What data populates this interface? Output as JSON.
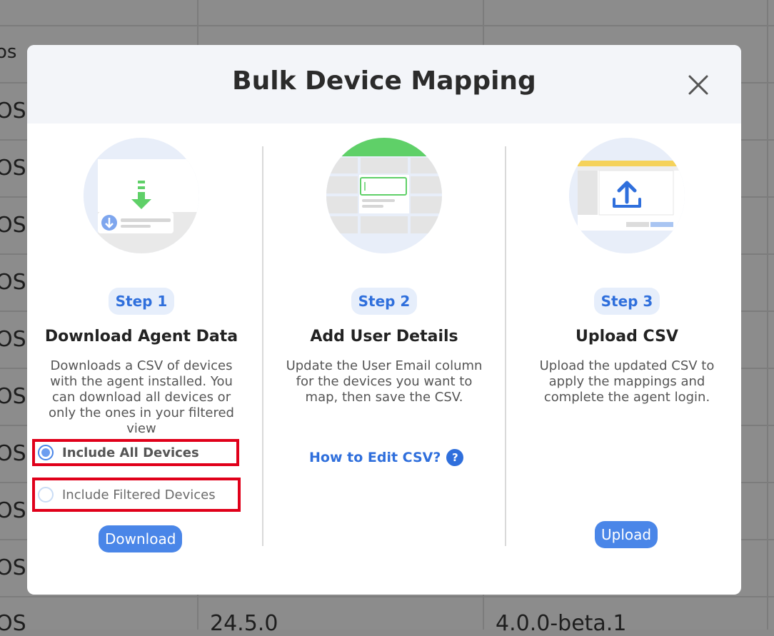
{
  "background": {
    "first_col_cells": [
      "os",
      "OS",
      "OS",
      "OS",
      "OS",
      "OS",
      "OS",
      "OS",
      "OS",
      "OS",
      "OS"
    ],
    "last_row": {
      "col2": "24.5.0",
      "col3": "4.0.0-beta.1"
    }
  },
  "modal": {
    "title": "Bulk Device Mapping",
    "close_icon": "close-icon",
    "steps": [
      {
        "pill": "Step 1",
        "title": "Download Agent Data",
        "description": "Downloads a CSV of devices with the agent installed. You can download all devices or only the ones in your filtered view",
        "options": [
          {
            "label": "Include All Devices",
            "selected": true
          },
          {
            "label": "Include Filtered Devices",
            "selected": false
          }
        ],
        "button": "Download"
      },
      {
        "pill": "Step 2",
        "title": "Add User Details",
        "description": "Update the User Email column for the devices you want to map, then save the CSV.",
        "link": "How to Edit CSV?",
        "link_icon": "?"
      },
      {
        "pill": "Step 3",
        "title": "Upload CSV",
        "description": "Upload the updated CSV to apply the mappings and complete the agent login.",
        "button": "Upload"
      }
    ]
  },
  "colors": {
    "accent": "#4a86e8",
    "link": "#2f6fdc",
    "highlight_box": "#e0001a",
    "green": "#5fd068",
    "yellow": "#f5d25a"
  }
}
